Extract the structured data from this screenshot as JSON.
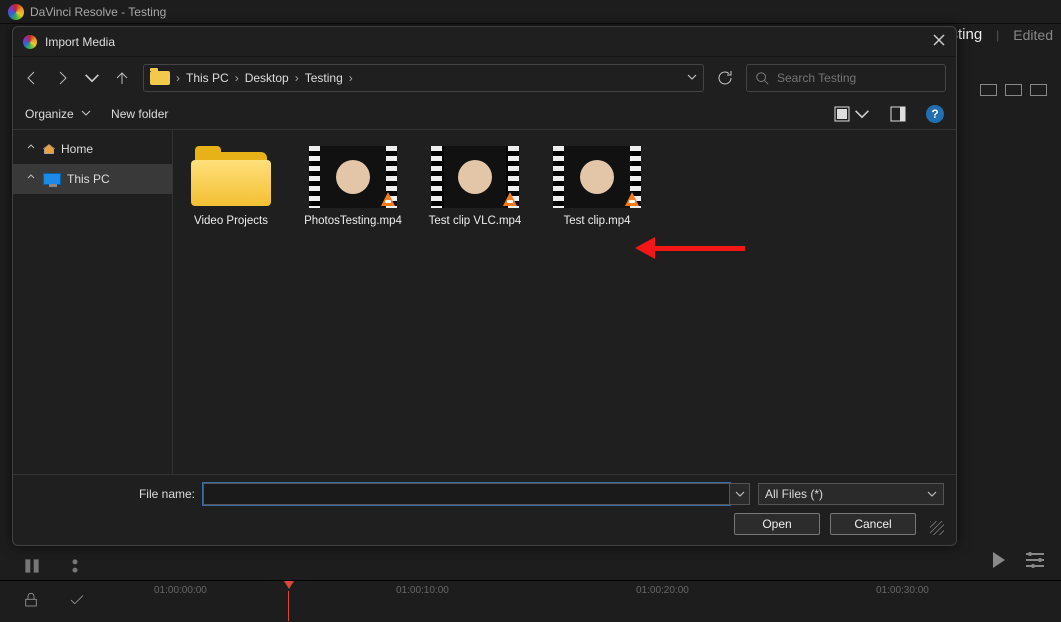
{
  "app": {
    "title": "DaVinci Resolve - Testing"
  },
  "bg": {
    "project": "sting",
    "status": "Edited",
    "timecodes": [
      "01:00:00:00",
      "01:00:10:00",
      "01:00:20:00",
      "01:00:30:00"
    ]
  },
  "dialog": {
    "title": "Import Media",
    "breadcrumbs": [
      "This PC",
      "Desktop",
      "Testing"
    ],
    "search": {
      "placeholder": "Search Testing"
    },
    "organize": "Organize",
    "newfolder": "New folder",
    "help_glyph": "?",
    "tree": {
      "home": "Home",
      "thispc": "This PC"
    },
    "items": [
      {
        "type": "folder",
        "label": "Video Projects"
      },
      {
        "type": "video",
        "label": "PhotosTesting.mp4",
        "rot": "rot180"
      },
      {
        "type": "video",
        "label": "Test clip VLC.mp4",
        "rot": "rot90"
      },
      {
        "type": "video",
        "label": "Test clip.mp4",
        "rot": ""
      }
    ],
    "footer": {
      "filenamelabel": "File name:",
      "filename": "",
      "filter": "All Files (*)",
      "open": "Open",
      "cancel": "Cancel"
    }
  }
}
